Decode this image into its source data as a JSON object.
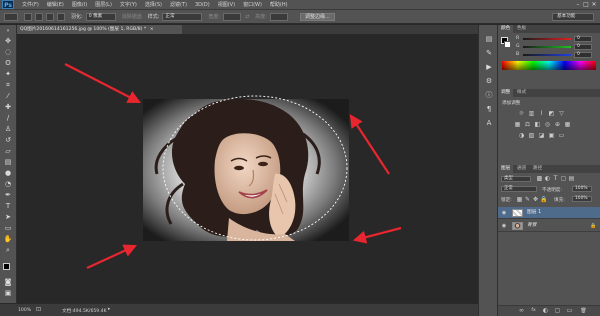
{
  "app": {
    "logo_text": "Ps"
  },
  "menu": [
    "文件(F)",
    "编辑(E)",
    "图像(I)",
    "图层(L)",
    "文字(Y)",
    "选择(S)",
    "滤镜(T)",
    "3D(D)",
    "视图(V)",
    "窗口(W)",
    "帮助(H)"
  ],
  "window_controls": {
    "minimize": "–",
    "maximize": "□",
    "close": "✕"
  },
  "options": {
    "feather_label": "羽化:",
    "feather_value": "0 像素",
    "antialias_label": "消除锯齿",
    "style_label": "样式:",
    "style_value": "正常",
    "width_label": "宽度:",
    "height_label": "高度:",
    "refine_button": "调整边缘...",
    "workspace_value": "基本功能"
  },
  "document": {
    "tab_title": "QQ图片20160614161256.jpg @ 100% (图层 1, RGB/8) *",
    "close_glyph": "×"
  },
  "status": {
    "zoom": "100%",
    "doc_info": "文档:494.5K/659.4K",
    "arrow": "▸"
  },
  "panels": {
    "color_tabs": [
      "颜色",
      "色板"
    ],
    "color_sliders": [
      {
        "label": "R",
        "value": "0",
        "gradient": [
          "#1a1a1a",
          "#e02020"
        ]
      },
      {
        "label": "G",
        "value": "0",
        "gradient": [
          "#1a1a1a",
          "#20c020"
        ]
      },
      {
        "label": "B",
        "value": "0",
        "gradient": [
          "#1a1a1a",
          "#2040e0"
        ]
      }
    ],
    "adjust_tabs": [
      "调整",
      "样式"
    ],
    "adjust_title": "添加调整",
    "layers_tabs": [
      "图层",
      "通道",
      "路径"
    ],
    "kind_label": "类型",
    "blend_mode": "正常",
    "opacity_label": "不透明度:",
    "opacity_value": "100%",
    "lock_label": "锁定:",
    "fill_label": "填充:",
    "fill_value": "100%",
    "layers": [
      {
        "name": "图层 1",
        "selected": true
      },
      {
        "name": "背景",
        "selected": false
      }
    ],
    "bottom_icons": [
      "∞",
      "fx",
      "◐",
      "▢",
      "▭",
      "🗑"
    ]
  },
  "colors": {
    "accent_arrow": "#e8262f",
    "panel_bg": "#535353",
    "selected_layer": "#4f6b8c"
  }
}
